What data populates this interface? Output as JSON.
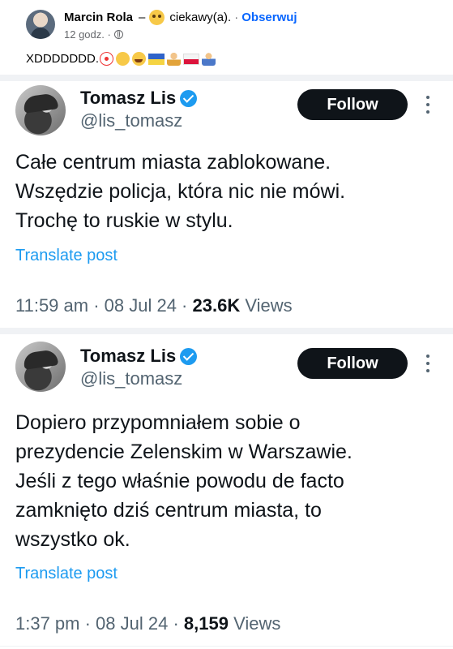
{
  "fb_post": {
    "author": "Marcin Rola",
    "dash": "–",
    "feeling": "ciekawy(a).",
    "separator": "·",
    "follow_label": "Obserwuj",
    "time": "12 godz. ·",
    "text": "XDDDDDDD.",
    "emojis": [
      "clown-face",
      "shushing-face",
      "rofl-face",
      "ukraine-flag",
      "person",
      "poland-flag",
      "person-shrugging"
    ]
  },
  "tweets": [
    {
      "name": "Tomasz Lis",
      "handle": "@lis_tomasz",
      "follow_label": "Follow",
      "body": "Całe centrum miasta zablokowane.\nWszędzie policja, która nic nie mówi.\nTrochę to ruskie w stylu.",
      "translate_label": "Translate post",
      "time": "11:59 am · 08 Jul 24 · ",
      "views_count": "23.6K",
      "views_label": " Views"
    },
    {
      "name": "Tomasz Lis",
      "handle": "@lis_tomasz",
      "follow_label": "Follow",
      "body": "Dopiero przypomniałem sobie o\nprezydencie Zelenskim w Warszawie.\nJeśli z tego właśnie powodu de facto\nzamknięto dziś centrum miasta, to\nwszystko ok.",
      "translate_label": "Translate post",
      "time": "1:37 pm · 08 Jul 24 · ",
      "views_count": "8,159",
      "views_label": " Views"
    }
  ],
  "colors": {
    "x_blue": "#1d9bf0",
    "fb_blue": "#0866ff",
    "follow_bg": "#0f1419",
    "muted": "#536471"
  }
}
